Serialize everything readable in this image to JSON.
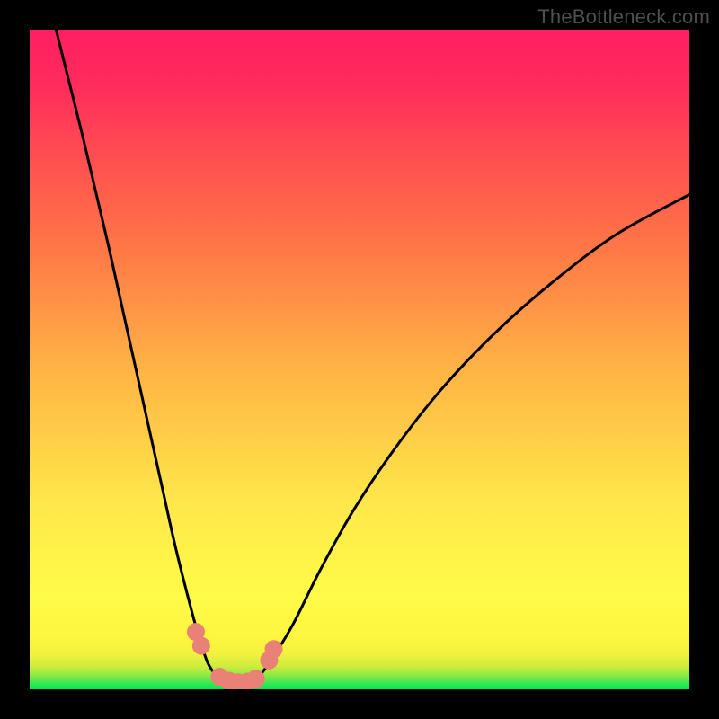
{
  "attribution": "TheBottleneck.com",
  "colors": {
    "frame": "#000000",
    "curve": "#000000",
    "dot": "#e98176",
    "attribution": "#4f4f4f"
  },
  "chart_data": {
    "type": "line",
    "title": "",
    "xlabel": "",
    "ylabel": "",
    "xlim": [
      0,
      100
    ],
    "ylim": [
      0,
      100
    ],
    "grid": false,
    "legend": false,
    "series": [
      {
        "name": "left-branch",
        "x": [
          4,
          6,
          8,
          10,
          12,
          14,
          16,
          18,
          20,
          22,
          24,
          25.5,
          27,
          28.5
        ],
        "y": [
          100,
          92,
          84,
          75.5,
          67,
          58,
          49,
          40,
          31,
          22,
          14,
          8.5,
          4,
          1.8
        ]
      },
      {
        "name": "right-branch",
        "x": [
          35,
          37,
          40,
          44,
          49,
          55,
          62,
          70,
          79,
          89,
          100
        ],
        "y": [
          2.2,
          5,
          10,
          18,
          27,
          36,
          45,
          53.5,
          61.5,
          69,
          75
        ]
      },
      {
        "name": "valley-floor",
        "x": [
          28.5,
          30,
          31.5,
          33,
          34,
          35
        ],
        "y": [
          1.8,
          1.2,
          1.0,
          1.0,
          1.3,
          2.2
        ]
      }
    ],
    "dots": {
      "name": "markers",
      "points": [
        {
          "x": 25.2,
          "y": 8.7
        },
        {
          "x": 26.0,
          "y": 6.6
        },
        {
          "x": 28.8,
          "y": 1.9
        },
        {
          "x": 30.2,
          "y": 1.3
        },
        {
          "x": 31.6,
          "y": 1.05
        },
        {
          "x": 33.0,
          "y": 1.15
        },
        {
          "x": 34.3,
          "y": 1.6
        },
        {
          "x": 36.3,
          "y": 4.4
        },
        {
          "x": 37.0,
          "y": 6.1
        }
      ]
    },
    "background_gradient": {
      "bottom": "#00e756",
      "mid": "#fff03f",
      "top": "#ff1f63"
    }
  }
}
